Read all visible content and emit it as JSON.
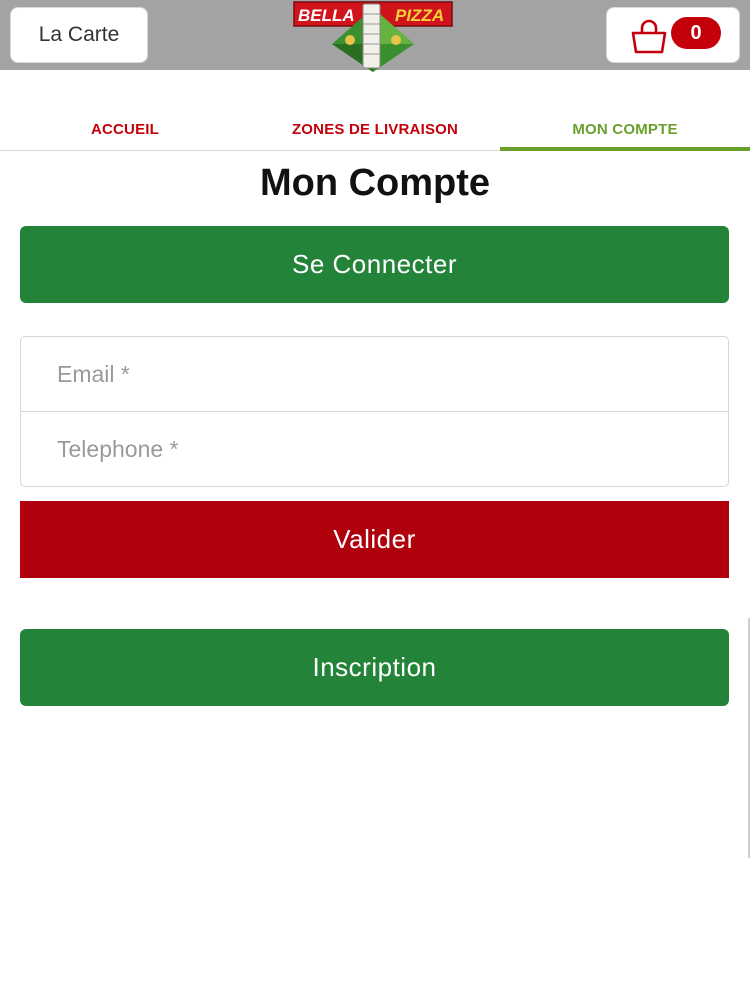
{
  "header": {
    "menu_label": "La Carte",
    "cart_count": "0",
    "logo": {
      "word1": "BELLA",
      "word2": "PIZZA"
    }
  },
  "tabs": [
    {
      "label": "ACCUEIL",
      "active": false
    },
    {
      "label": "ZONES DE LIVRAISON",
      "active": false
    },
    {
      "label": "MON COMPTE",
      "active": true
    }
  ],
  "main": {
    "title": "Mon Compte",
    "login_label": "Se Connecter",
    "email_placeholder": "Email *",
    "phone_placeholder": "Telephone *",
    "submit_label": "Valider",
    "register_label": "Inscription"
  },
  "colors": {
    "brand_red": "#c4000b",
    "brand_green": "#238439",
    "active_tab": "#6a9f2c",
    "header_bg": "#a3a3a3"
  },
  "icons": {
    "cart": "shopping-bag-icon"
  }
}
